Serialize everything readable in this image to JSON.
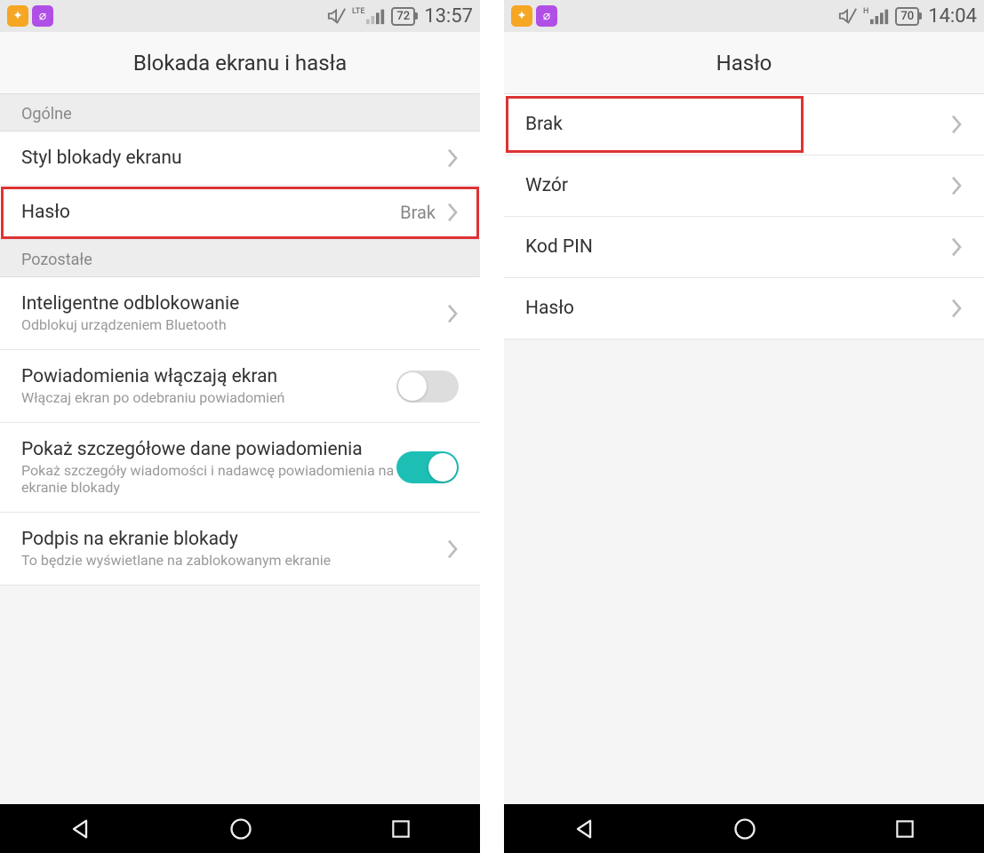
{
  "left": {
    "status": {
      "battery": "72",
      "time": "13:57",
      "net": "LTE"
    },
    "header": "Blokada ekranu i hasła",
    "section1": "Ogólne",
    "row_style": "Styl blokady ekranu",
    "row_password": {
      "label": "Hasło",
      "value": "Brak"
    },
    "section2": "Pozostałe",
    "row_smart": {
      "title": "Inteligentne odblokowanie",
      "sub": "Odblokuj urządzeniem Bluetooth"
    },
    "row_notif_wake": {
      "title": "Powiadomienia włączają ekran",
      "sub": "Włączaj ekran po odebraniu powiadomień"
    },
    "row_notif_detail": {
      "title": "Pokaż szczegółowe dane powiadomienia",
      "sub": "Pokaż szczegóły wiadomości i nadawcę powiadomienia na ekranie blokady"
    },
    "row_signature": {
      "title": "Podpis na ekranie blokady",
      "sub": "To będzie wyświetlane na zablokowanym ekranie"
    }
  },
  "right": {
    "status": {
      "battery": "70",
      "time": "14:04",
      "net": "H"
    },
    "header": "Hasło",
    "rows": {
      "none": "Brak",
      "pattern": "Wzór",
      "pin": "Kod PIN",
      "password": "Hasło"
    }
  }
}
